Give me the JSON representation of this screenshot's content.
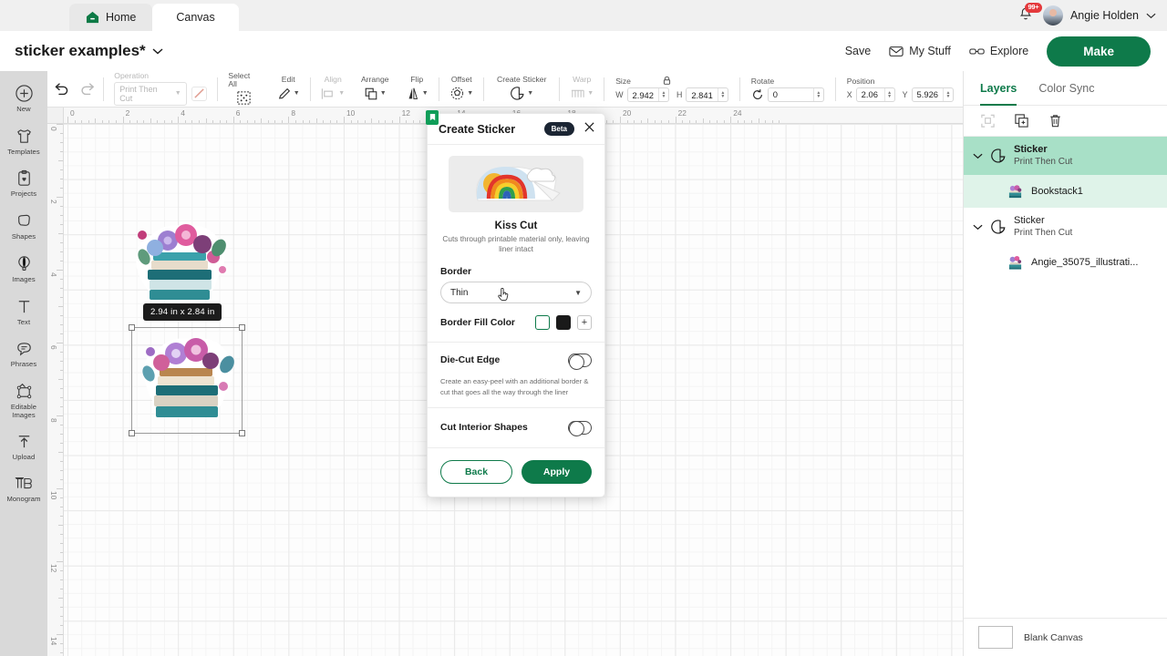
{
  "tabs": {
    "home": "Home",
    "canvas": "Canvas",
    "home_icon": "home-icon"
  },
  "account": {
    "name": "Angie Holden",
    "notifications": "99+",
    "bell_icon": "bell-icon",
    "chevron": "chevron-down-icon"
  },
  "project": {
    "title": "sticker examples*",
    "chevron": "chevron-down-icon"
  },
  "actions": {
    "save": "Save",
    "my_stuff": "My Stuff",
    "explore": "Explore",
    "make": "Make",
    "make_color": "#0e7a4a"
  },
  "sidebar": {
    "items": [
      {
        "label": "New",
        "icon": "plus-circle-icon"
      },
      {
        "label": "Templates",
        "icon": "tshirt-icon"
      },
      {
        "label": "Projects",
        "icon": "clipboard-heart-icon"
      },
      {
        "label": "Shapes",
        "icon": "shapes-icon"
      },
      {
        "label": "Images",
        "icon": "hot-air-balloon-icon"
      },
      {
        "label": "Text",
        "icon": "text-t-icon"
      },
      {
        "label": "Phrases",
        "icon": "speech-bubble-icon"
      },
      {
        "label": "Editable Images",
        "icon": "editable-images-icon"
      },
      {
        "label": "Upload",
        "icon": "upload-arrow-icon"
      },
      {
        "label": "Monogram",
        "icon": "monogram-icon"
      }
    ]
  },
  "toolbar": {
    "undo": "undo-icon",
    "redo": "redo-icon",
    "operation_label": "Operation",
    "operation_value": "Print Then Cut",
    "select_all": "Select All",
    "edit": "Edit",
    "align": "Align",
    "arrange": "Arrange",
    "flip": "Flip",
    "offset": "Offset",
    "create_sticker": "Create Sticker",
    "warp": "Warp"
  },
  "transform": {
    "size_label": "Size",
    "w_label": "W",
    "w_value": "2.942",
    "h_label": "H",
    "h_value": "2.841",
    "lock_icon": "lock-icon",
    "rotate_label": "Rotate",
    "rotate_value": "0",
    "rotate_icon": "rotate-icon",
    "position_label": "Position",
    "x_label": "X",
    "x_value": "2.06",
    "y_label": "Y",
    "y_value": "5.926"
  },
  "canvas": {
    "ruler_h": [
      "0",
      "2",
      "4",
      "6",
      "8",
      "10",
      "12",
      "14",
      "16",
      "18",
      "20",
      "22",
      "24"
    ],
    "ruler_v": [
      "0",
      "2",
      "4",
      "6",
      "8",
      "10",
      "12",
      "14"
    ],
    "size_badge": "2.94  in x 2.84  in",
    "artwork_name": "floral-bookstack-sticker"
  },
  "panel": {
    "title": "Create Sticker",
    "beta": "Beta",
    "close_icon": "close-icon",
    "preview_icon": "rainbow-sticker-preview",
    "cut_name": "Kiss Cut",
    "cut_desc": "Cuts through printable material only, leaving liner intact",
    "border_label": "Border",
    "border_value": "Thin",
    "border_chevron": "chevron-down-icon",
    "fill_label": "Border Fill Color",
    "swatch_selected": "#ffffff",
    "swatch_black": "#1a1a1a",
    "swatch_add": "+",
    "die_cut_label": "Die-Cut Edge",
    "die_cut_desc": "Create an easy-peel with an additional border & cut that goes all the way through the liner",
    "cut_interior_label": "Cut Interior Shapes",
    "back": "Back",
    "apply": "Apply",
    "accent": "#0e7a4a"
  },
  "layers": {
    "tab_layers": "Layers",
    "tab_color_sync": "Color Sync",
    "action_group": "group-icon",
    "action_duplicate": "duplicate-icon",
    "action_delete": "trash-icon",
    "items": [
      {
        "title": "Sticker",
        "subtitle": "Print Then Cut",
        "child": "Bookstack1"
      },
      {
        "title": "Sticker",
        "subtitle": "Print Then Cut",
        "child": "Angie_35075_illustrati..."
      }
    ],
    "footer_label": "Blank Canvas",
    "footer_color": "#ffffff",
    "selected_color": "#a8e0c7"
  }
}
